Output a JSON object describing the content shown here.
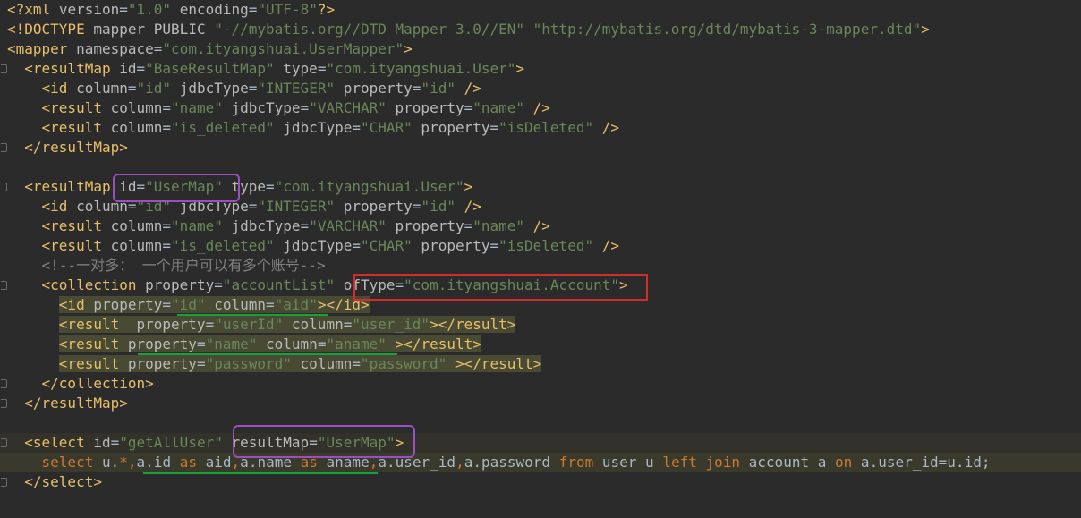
{
  "editor": {
    "language": "XML",
    "lines": [
      "<?xml version=\"1.0\" encoding=\"UTF-8\"?>",
      "<!DOCTYPE mapper PUBLIC \"-//mybatis.org//DTD Mapper 3.0//EN\" \"http://mybatis.org/dtd/mybatis-3-mapper.dtd\">",
      "<mapper namespace=\"com.ityangshuai.UserMapper\">",
      "  <resultMap id=\"BaseResultMap\" type=\"com.ityangshuai.User\">",
      "    <id column=\"id\" jdbcType=\"INTEGER\" property=\"id\" />",
      "    <result column=\"name\" jdbcType=\"VARCHAR\" property=\"name\" />",
      "    <result column=\"is_deleted\" jdbcType=\"CHAR\" property=\"isDeleted\" />",
      "  </resultMap>",
      "",
      "  <resultMap id=\"UserMap\" type=\"com.ityangshuai.User\">",
      "    <id column=\"id\" jdbcType=\"INTEGER\" property=\"id\" />",
      "    <result column=\"name\" jdbcType=\"VARCHAR\" property=\"name\" />",
      "    <result column=\"is_deleted\" jdbcType=\"CHAR\" property=\"isDeleted\" />",
      "    <!--一对多： 一个用户可以有多个账号-->",
      "    <collection property=\"accountList\" ofType=\"com.ityangshuai.Account\">",
      "      <id property=\"id\" column=\"aid\"></id>",
      "      <result  property=\"userId\" column=\"user_id\"></result>",
      "      <result property=\"name\" column=\"aname\" ></result>",
      "      <result property=\"password\" column=\"password\" ></result>",
      "    </collection>",
      "  </resultMap>",
      "",
      "  <select id=\"getAllUser\" resultMap=\"UserMap\">",
      "    select u.*,a.id as aid,a.name as aname,a.user_id,a.password from user u left join account a on a.user_id=u.id;",
      "  </select>"
    ]
  },
  "colors": {
    "background": "#2b2b2b",
    "tag": "#e8bf6a",
    "attribute": "#bababa",
    "value": "#6a8759",
    "keyword": "#cc7832",
    "comment": "#808080",
    "annotation_purple": "#9b4fc0",
    "annotation_red": "#d22d2d",
    "annotation_green": "#14a33a"
  }
}
